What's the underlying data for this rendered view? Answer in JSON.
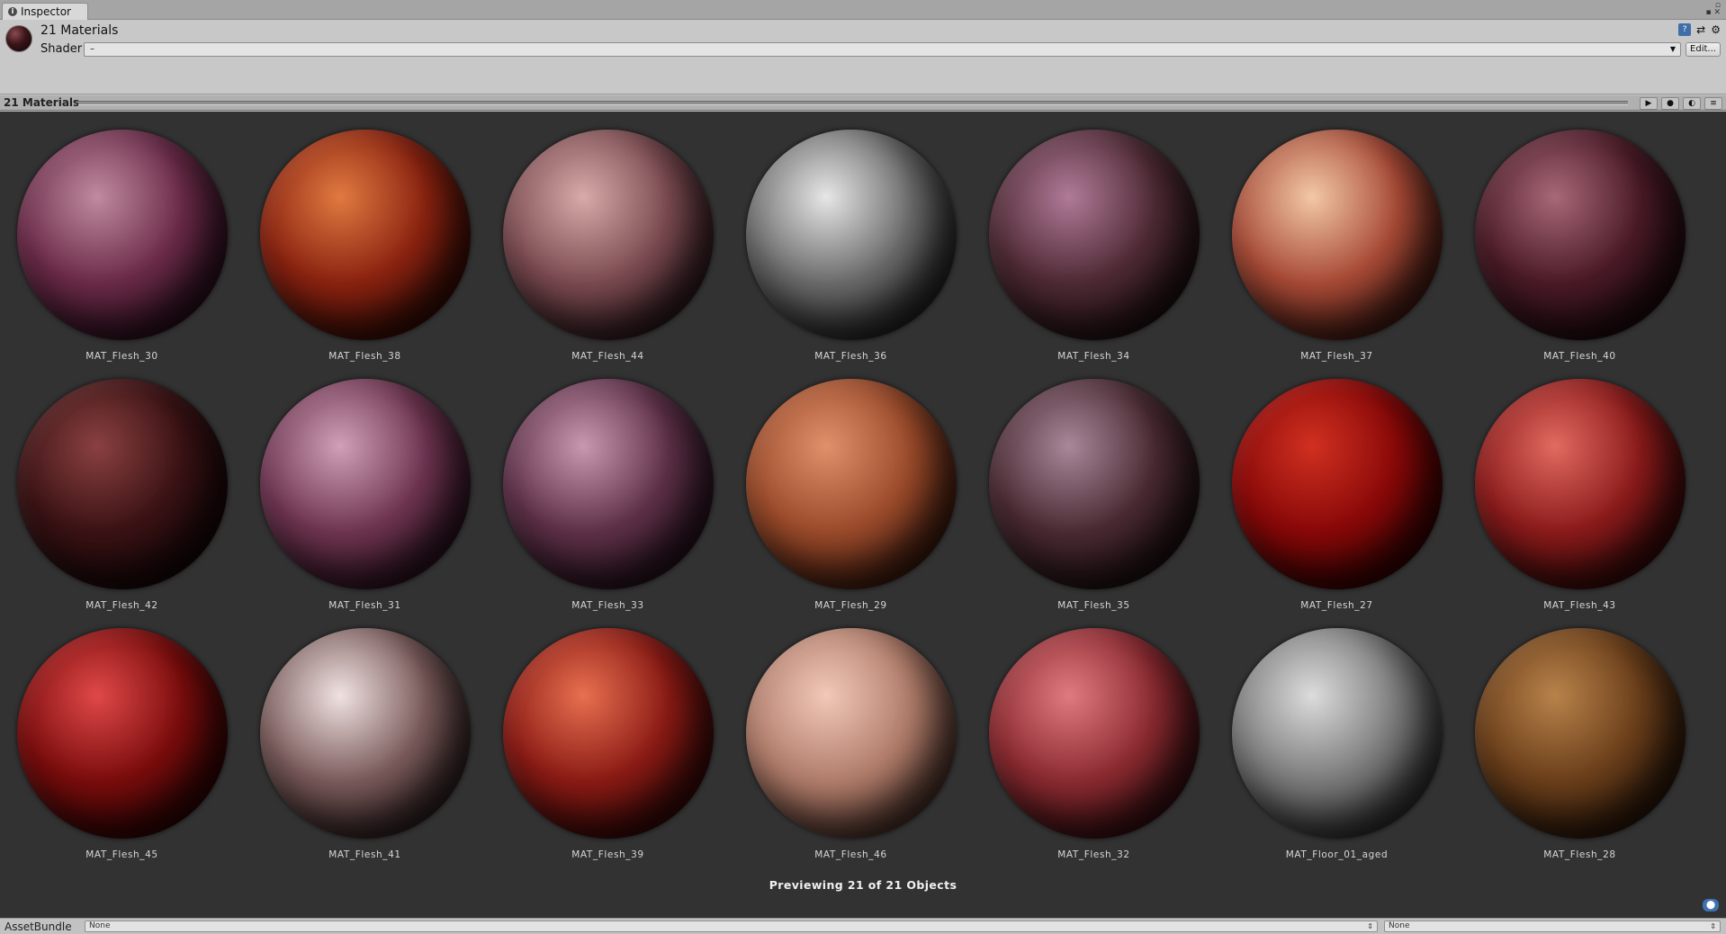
{
  "tab": {
    "label": "Inspector",
    "icon": "info-icon"
  },
  "header": {
    "title": "21 Materials",
    "shader_label": "Shader",
    "shader_value": "–",
    "edit_label": "Edit..."
  },
  "preview_bar": {
    "title": "21 Materials"
  },
  "materials": [
    {
      "name": "MAT_Flesh_30",
      "colors": [
        "#c08aa0",
        "#6a2a48",
        "#1e0812"
      ]
    },
    {
      "name": "MAT_Flesh_38",
      "colors": [
        "#e07a40",
        "#8a2210",
        "#220603"
      ]
    },
    {
      "name": "MAT_Flesh_44",
      "colors": [
        "#d8aaa8",
        "#7a4a50",
        "#1c0c10"
      ]
    },
    {
      "name": "MAT_Flesh_36",
      "colors": [
        "#e6e6e6",
        "#6a6a6a",
        "#0e0e0e"
      ]
    },
    {
      "name": "MAT_Flesh_34",
      "colors": [
        "#b07a98",
        "#4e2a34",
        "#140808"
      ]
    },
    {
      "name": "MAT_Flesh_37",
      "colors": [
        "#f2c8a6",
        "#a84a36",
        "#2a0c08"
      ]
    },
    {
      "name": "MAT_Flesh_40",
      "colors": [
        "#a86878",
        "#4a1a26",
        "#120508"
      ]
    },
    {
      "name": "MAT_Flesh_42",
      "colors": [
        "#8a4040",
        "#3a1214",
        "#0c0304"
      ]
    },
    {
      "name": "MAT_Flesh_31",
      "colors": [
        "#d0a0b8",
        "#6e3450",
        "#1c0814"
      ]
    },
    {
      "name": "MAT_Flesh_33",
      "colors": [
        "#c898b0",
        "#5e3048",
        "#180a12"
      ]
    },
    {
      "name": "MAT_Flesh_29",
      "colors": [
        "#e0906a",
        "#9a4a2a",
        "#2a0e06"
      ]
    },
    {
      "name": "MAT_Flesh_35",
      "colors": [
        "#a8889a",
        "#4a2a32",
        "#120808"
      ]
    },
    {
      "name": "MAT_Flesh_27",
      "colors": [
        "#d03020",
        "#880808",
        "#220000"
      ]
    },
    {
      "name": "MAT_Flesh_43",
      "colors": [
        "#e26a60",
        "#8a1a1a",
        "#200404"
      ]
    },
    {
      "name": "MAT_Flesh_45",
      "colors": [
        "#e04848",
        "#7a0c0c",
        "#1c0202"
      ]
    },
    {
      "name": "MAT_Flesh_41",
      "colors": [
        "#f0e2e2",
        "#7a5a5a",
        "#1c1010"
      ]
    },
    {
      "name": "MAT_Flesh_39",
      "colors": [
        "#e87050",
        "#8a1a14",
        "#200404"
      ]
    },
    {
      "name": "MAT_Flesh_46",
      "colors": [
        "#f2c8b8",
        "#b07c6a",
        "#3a221a"
      ]
    },
    {
      "name": "MAT_Flesh_32",
      "colors": [
        "#e07a80",
        "#8a2a30",
        "#200608"
      ]
    },
    {
      "name": "MAT_Floor_01_aged",
      "colors": [
        "#dcdcdc",
        "#7a7a7a",
        "#1e1e1e"
      ]
    },
    {
      "name": "MAT_Flesh_28",
      "colors": [
        "#b8824a",
        "#6a3e1a",
        "#1c0e06"
      ]
    }
  ],
  "previewing_text": "Previewing 21 of 21 Objects",
  "footer": {
    "label": "AssetBundle",
    "bundle_value": "None",
    "variant_value": "None"
  }
}
